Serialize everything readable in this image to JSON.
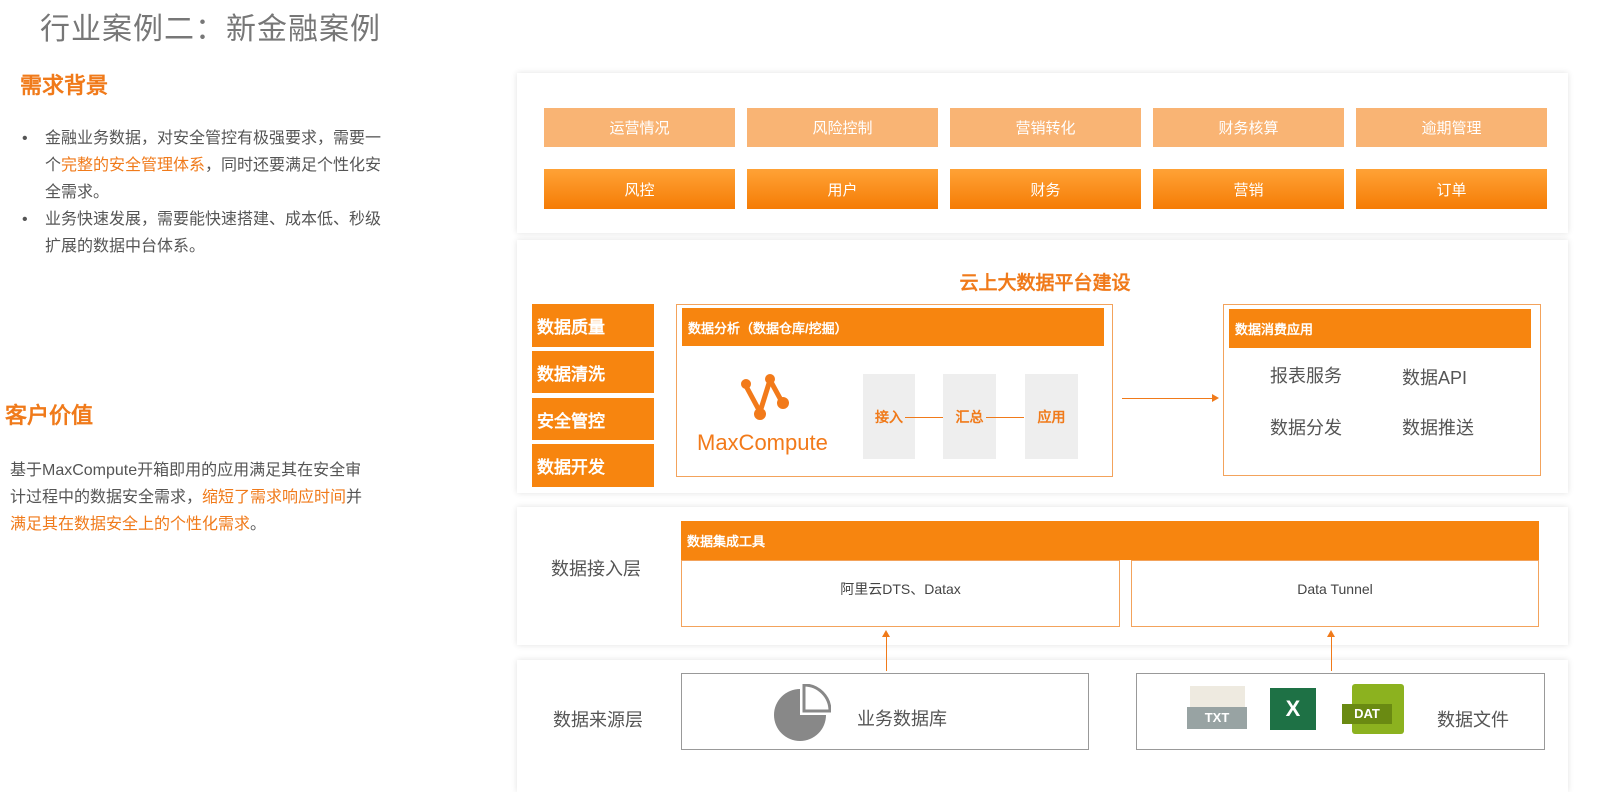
{
  "title": "行业案例二：新金融案例",
  "need": {
    "heading": "需求背景",
    "b1_a": "金融业务数据，对安全管控有极强要求，需要一",
    "b1_b": "个",
    "b1_hl": "完整的安全管理体系",
    "b1_c": "，同时还要满足个性化安",
    "b1_d": "全需求。",
    "b2_a": "业务快速发展，需要能快速搭建、成本低、秒级",
    "b2_b": "扩展的数据中台体系。"
  },
  "value": {
    "heading": "客户价值",
    "l1": "基于MaxCompute开箱即用的应用满足其在安全审",
    "l2": "计过程中的数据安全需求，",
    "l2_hl": "缩短了需求响应时间",
    "l2_end": "并",
    "l3_hl": "满足其在数据安全上的个性化需求",
    "l3_end": "。"
  },
  "diagram": {
    "top_row": [
      "运营情况",
      "风险控制",
      "营销转化",
      "财务核算",
      "逾期管理"
    ],
    "domain_row": [
      "风控",
      "用户",
      "财务",
      "营销",
      "订单"
    ],
    "platform_title": "云上大数据平台建设",
    "side": [
      "数据质量",
      "数据清洗",
      "安全管控",
      "数据开发"
    ],
    "analysis_header": "数据分析（数据仓库/挖掘）",
    "logo_text": "MaxCompute",
    "steps": [
      "接入",
      "汇总",
      "应用"
    ],
    "consume_header": "数据消费应用",
    "consume": [
      "报表服务",
      "数据API",
      "数据分发",
      "数据推送"
    ],
    "ingest_label": "数据接入层",
    "ingest_header": "数据集成工具",
    "ingest_tools": [
      "阿里云DTS、Datax",
      "Data Tunnel"
    ],
    "source_label": "数据来源层",
    "source_db": "业务数据库",
    "source_files": "数据文件",
    "file_icons": [
      "TXT",
      "X",
      "DAT"
    ]
  }
}
